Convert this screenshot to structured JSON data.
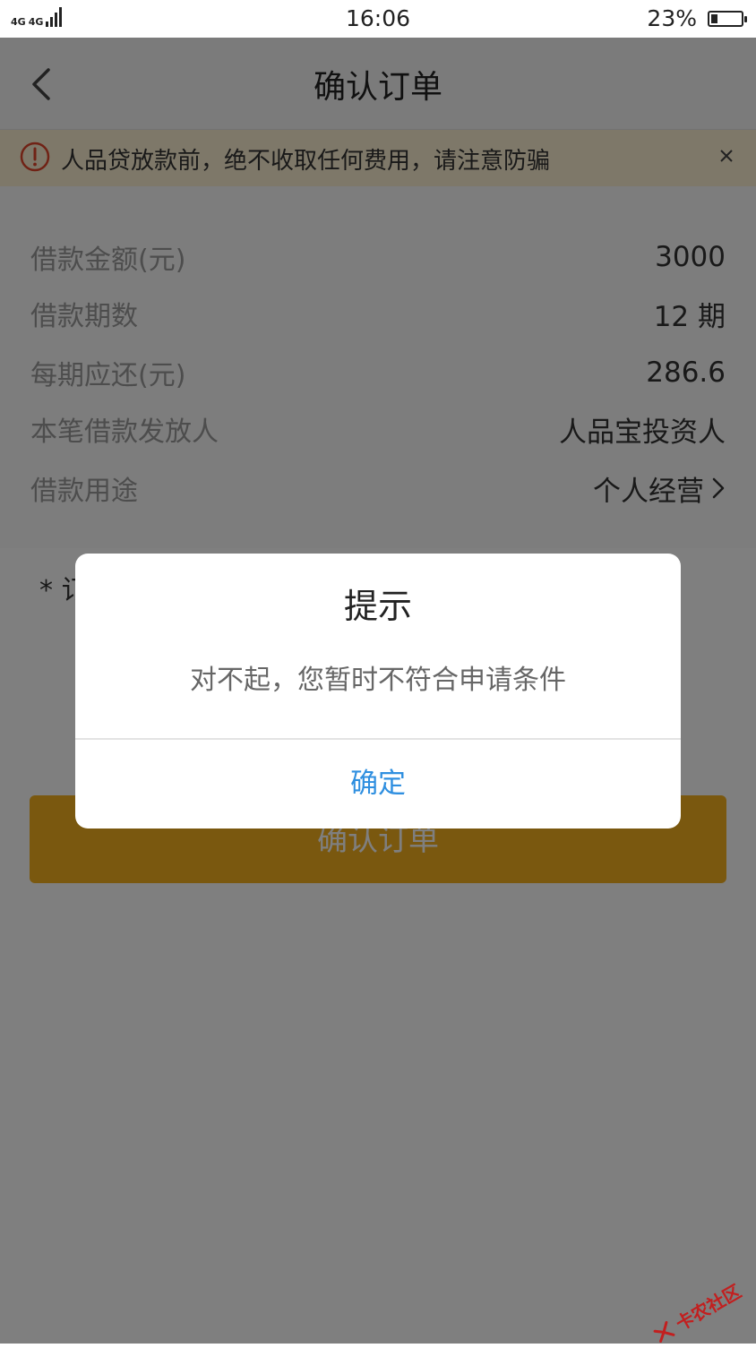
{
  "status_bar": {
    "network": "4G",
    "network2": "4G",
    "time": "16:06",
    "battery_percent": "23%",
    "battery_level": 0.23
  },
  "header": {
    "title": "确认订单",
    "back_icon": "chevron-left-icon"
  },
  "notice": {
    "text": "人品贷放款前，绝不收取任何费用，请注意防骗",
    "icon": "warning-circle-icon",
    "close_icon": "close-icon"
  },
  "details": [
    {
      "label": "借款金额(元)",
      "value": "3000"
    },
    {
      "label": "借款期数",
      "value": "12 期"
    },
    {
      "label": "每期应还(元)",
      "value": "286.6"
    },
    {
      "label": "本笔借款发放人",
      "value": "人品宝投资人"
    },
    {
      "label": "借款用途",
      "value": "个人经营"
    }
  ],
  "note": {
    "text": "* 订"
  },
  "confirm_button": {
    "label": "确认订单",
    "color": "#f5b01f"
  },
  "dialog": {
    "title": "提示",
    "message": "对不起，您暂时不符合申请条件",
    "ok_label": "确定",
    "ok_color": "#2f8fe0"
  },
  "watermark": {
    "text": "卡农社区"
  }
}
